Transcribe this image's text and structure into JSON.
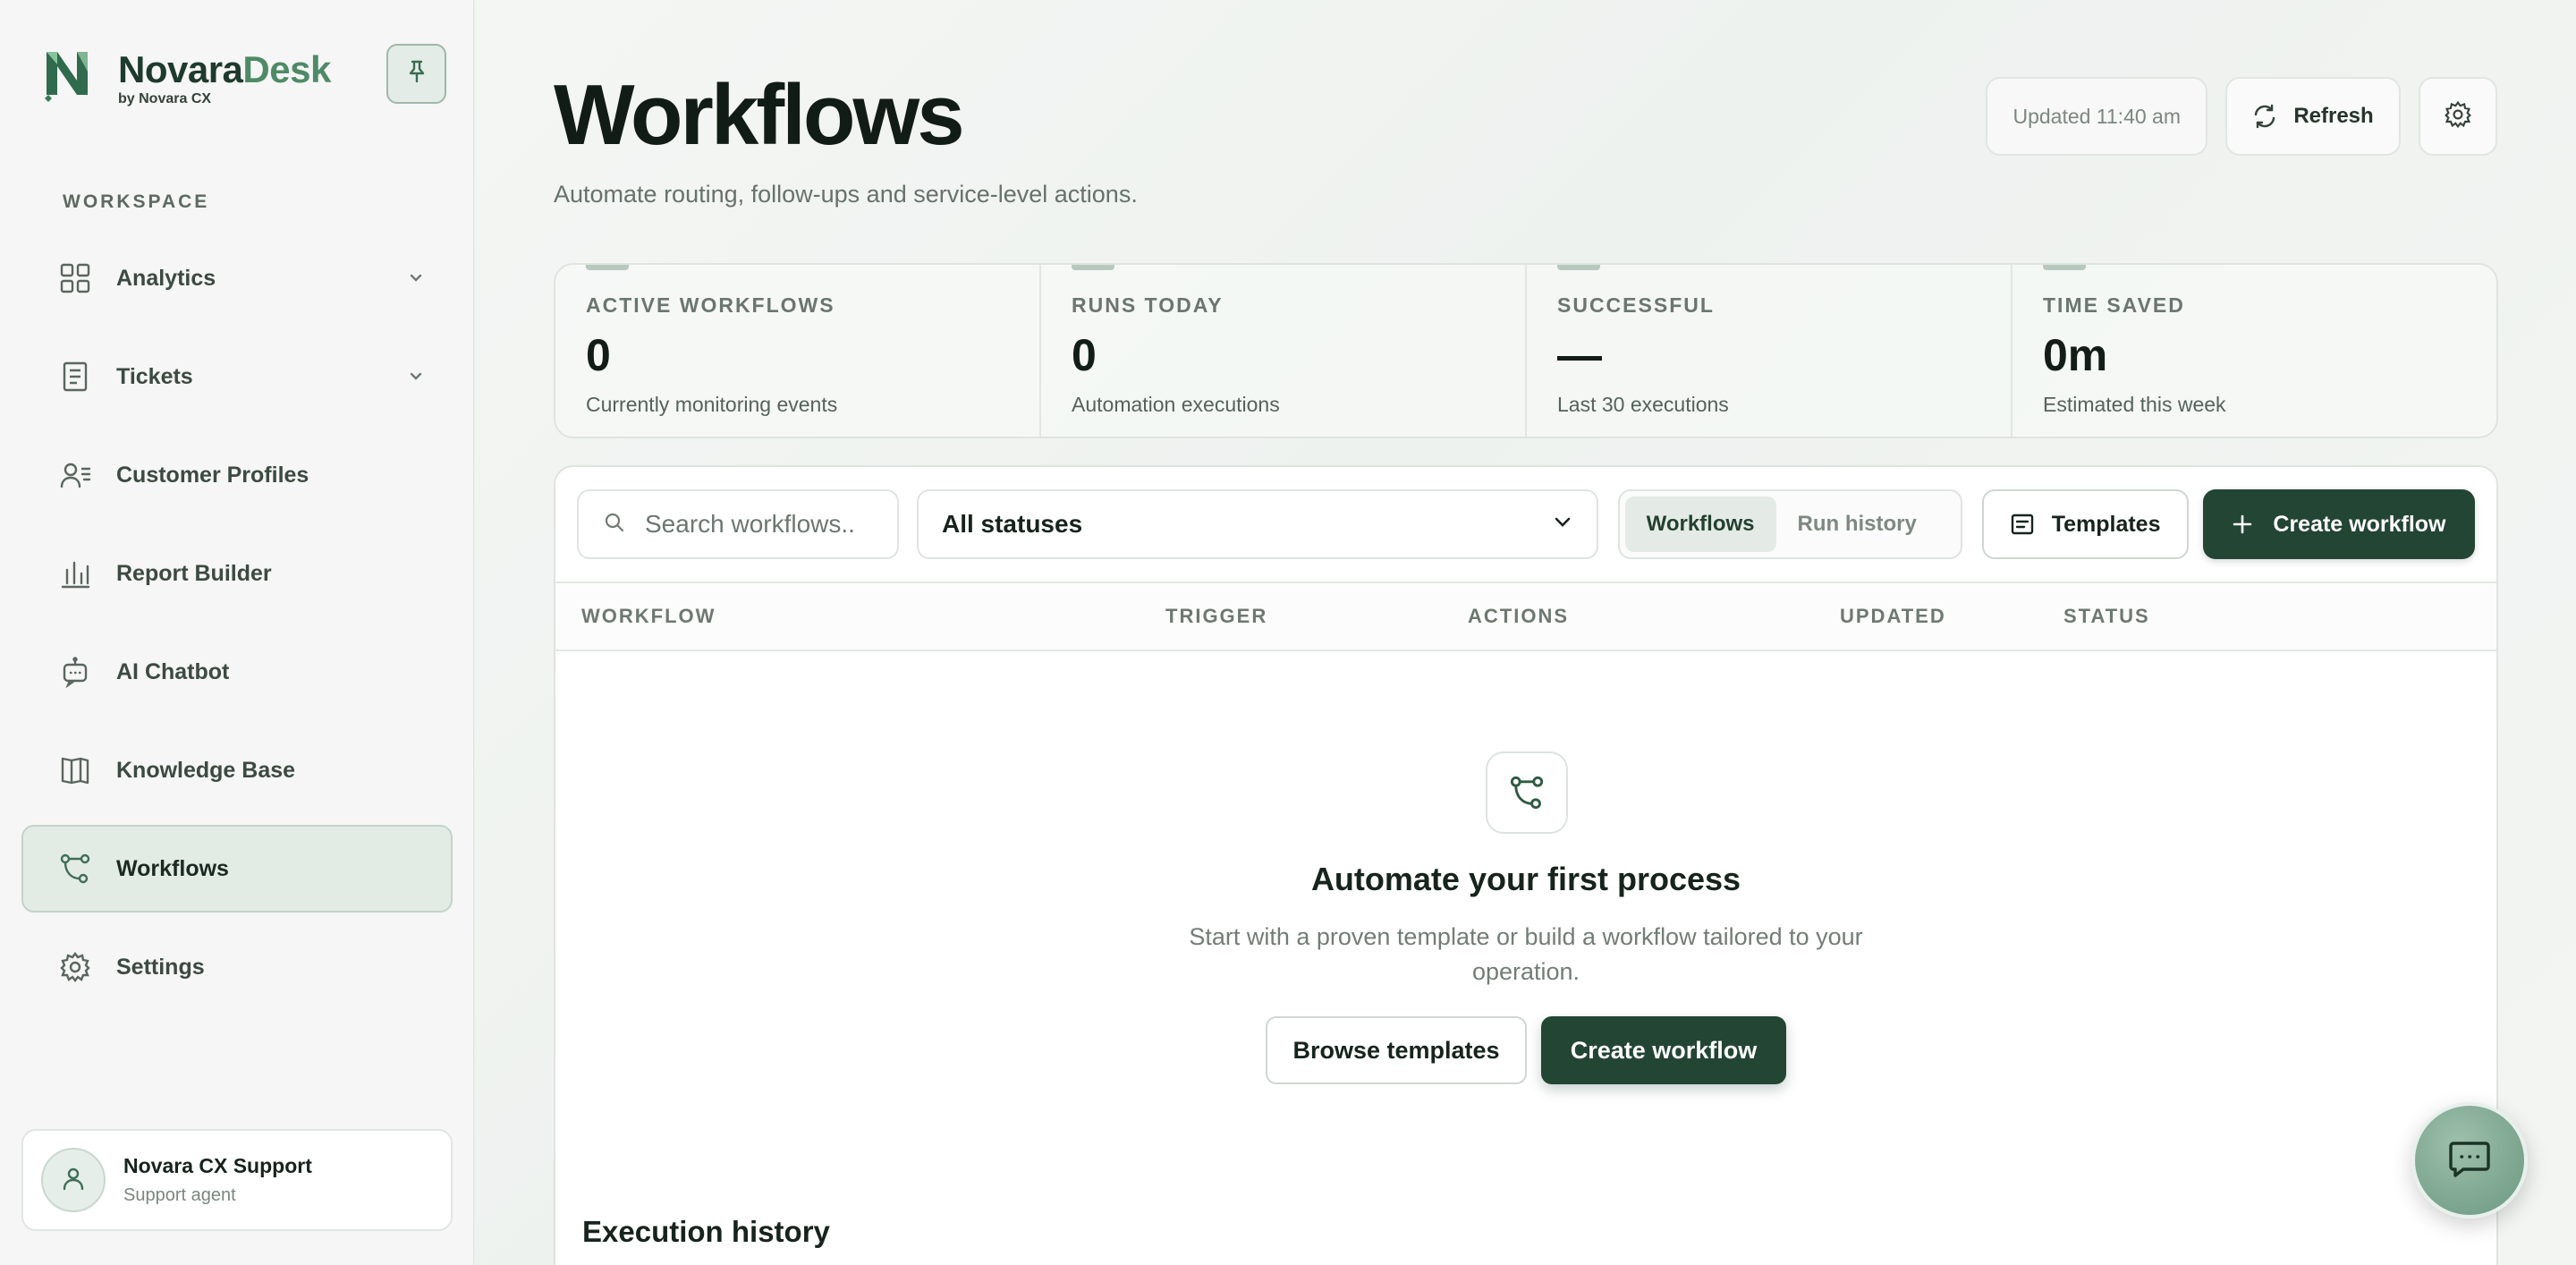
{
  "brand": {
    "name_part1": "Novara",
    "name_part2": "Desk",
    "subtitle": "by Novara CX",
    "accent": "#4f8a67"
  },
  "sidebar": {
    "section_label": "WORKSPACE",
    "items": [
      {
        "label": "Analytics",
        "icon": "grid-icon",
        "has_chevron": true
      },
      {
        "label": "Tickets",
        "icon": "document-icon",
        "has_chevron": true
      },
      {
        "label": "Customer Profiles",
        "icon": "users-list-icon"
      },
      {
        "label": "Report Builder",
        "icon": "bar-chart-icon"
      },
      {
        "label": "AI Chatbot",
        "icon": "bot-icon"
      },
      {
        "label": "Knowledge Base",
        "icon": "book-icon"
      },
      {
        "label": "Workflows",
        "icon": "workflow-icon",
        "active": true
      },
      {
        "label": "Settings",
        "icon": "gear-icon"
      }
    ],
    "user": {
      "name": "Novara CX Support",
      "role": "Support agent"
    }
  },
  "header": {
    "title": "Workflows",
    "subtitle": "Automate routing, follow-ups and service-level actions.",
    "updated": "Updated 11:40 am",
    "refresh_label": "Refresh"
  },
  "stats": [
    {
      "label": "ACTIVE WORKFLOWS",
      "value": "0",
      "desc": "Currently monitoring events"
    },
    {
      "label": "RUNS TODAY",
      "value": "0",
      "desc": "Automation executions"
    },
    {
      "label": "SUCCESSFUL",
      "value": "—",
      "desc": "Last 30 executions"
    },
    {
      "label": "TIME SAVED",
      "value": "0m",
      "desc": "Estimated this week"
    }
  ],
  "toolbar": {
    "search_placeholder": "Search workflows..",
    "status_selected": "All statuses",
    "seg_workflows": "Workflows",
    "seg_history": "Run history",
    "templates_label": "Templates",
    "create_label": "Create workflow"
  },
  "table": {
    "columns": [
      "WORKFLOW",
      "TRIGGER",
      "ACTIONS",
      "UPDATED",
      "STATUS"
    ]
  },
  "empty": {
    "title": "Automate your first process",
    "desc": "Start with a proven template or build a workflow tailored to your operation.",
    "browse_label": "Browse templates",
    "create_label": "Create workflow"
  },
  "execution": {
    "title": "Execution history"
  },
  "colors": {
    "primary": "#234534",
    "accent": "#4f8a67",
    "surface": "#ffffff"
  }
}
